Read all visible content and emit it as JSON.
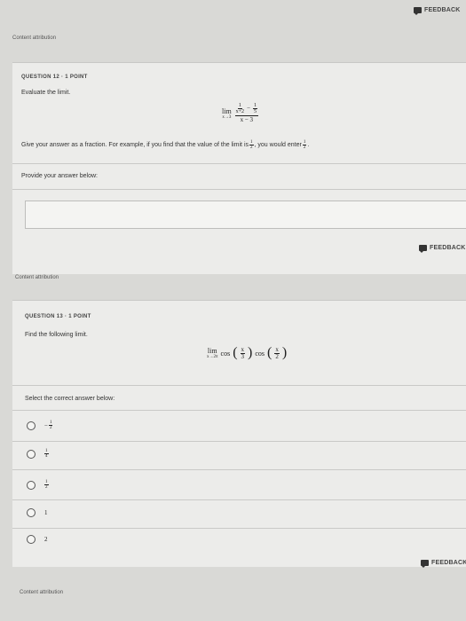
{
  "feedback_label": "FEEDBACK",
  "content_attribution": "Content attribution",
  "q12": {
    "header": "QUESTION 12 · 1 POINT",
    "prompt": "Evaluate the limit.",
    "limit": {
      "operator": "lim",
      "subscript": "x→3",
      "numerator": {
        "term1_num": "1",
        "term1_den": "x+2",
        "minus": "−",
        "term2_num": "1",
        "term2_den": "5"
      },
      "denominator": "x − 3"
    },
    "instruction_part1": "Give your answer as a fraction. For example, if you find that the value of the limit is ",
    "example_num": "1",
    "example_den": "2",
    "instruction_part2": ", you would enter ",
    "instruction_end": ".",
    "answer_label": "Provide your answer below:",
    "answer_value": ""
  },
  "q13": {
    "header": "QUESTION 13 · 1 POINT",
    "prompt": "Find the following limit.",
    "limit": {
      "operator": "lim",
      "subscript": "x→2π",
      "cos": "cos",
      "arg1_num": "x",
      "arg1_den": "3",
      "arg2_num": "x",
      "arg2_den": "2"
    },
    "answer_label": "Select the correct answer below:",
    "options": [
      {
        "sign": "−",
        "num": "1",
        "den": "2"
      },
      {
        "sign": "",
        "num": "1",
        "den": "4"
      },
      {
        "sign": "",
        "num": "1",
        "den": "2"
      },
      {
        "sign": "",
        "num": "1",
        "den": ""
      },
      {
        "sign": "",
        "num": "2",
        "den": ""
      }
    ]
  }
}
